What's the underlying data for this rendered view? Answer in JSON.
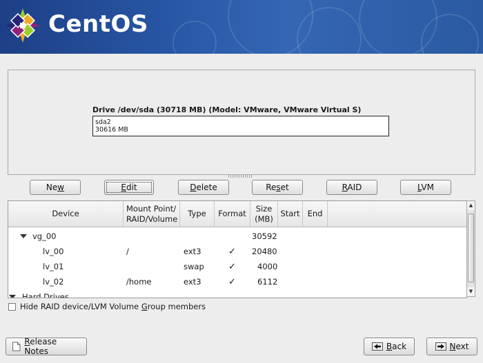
{
  "header": {
    "brand": "CentOS"
  },
  "drive": {
    "title": "Drive /dev/sda (30718 MB) (Model: VMware, VMware Virtual S)",
    "partition_name": "sda2",
    "partition_size": "30616 MB"
  },
  "toolbar": {
    "new": {
      "pre": "Ne",
      "u": "w",
      "post": ""
    },
    "edit": {
      "pre": "",
      "u": "E",
      "post": "dit"
    },
    "delete": {
      "pre": "",
      "u": "D",
      "post": "elete"
    },
    "reset": {
      "pre": "Re",
      "u": "s",
      "post": "et"
    },
    "raid": {
      "pre": "",
      "u": "R",
      "post": "AID"
    },
    "lvm": {
      "pre": "",
      "u": "L",
      "post": "VM"
    }
  },
  "table": {
    "columns": {
      "device": "Device",
      "mount_line1": "Mount Point/",
      "mount_line2": "RAID/Volume",
      "type": "Type",
      "format": "Format",
      "size_line1": "Size",
      "size_line2": "(MB)",
      "start": "Start",
      "end": "End"
    },
    "rows": [
      {
        "device": "vg_00",
        "mount": "",
        "type": "",
        "format": "",
        "size": "30592"
      },
      {
        "device": "lv_00",
        "mount": "/",
        "type": "ext3",
        "format": "✓",
        "size": "20480"
      },
      {
        "device": "lv_01",
        "mount": "",
        "type": "swap",
        "format": "✓",
        "size": "4000"
      },
      {
        "device": "lv_02",
        "mount": "/home",
        "type": "ext3",
        "format": "✓",
        "size": "6112"
      },
      {
        "device": "Hard Drives",
        "mount": "",
        "type": "",
        "format": "",
        "size": ""
      }
    ]
  },
  "hide_members": {
    "pre": "Hide RAID device/LVM Volume ",
    "u": "G",
    "post": "roup members",
    "checked": false
  },
  "footer": {
    "release_notes": {
      "pre": "",
      "u": "R",
      "post": "elease Notes"
    },
    "back": {
      "pre": "",
      "u": "B",
      "post": "ack"
    },
    "next": {
      "pre": "",
      "u": "N",
      "post": "ext"
    }
  },
  "colors": {
    "banner": "#2a5aa9",
    "panel": "#ededed"
  }
}
